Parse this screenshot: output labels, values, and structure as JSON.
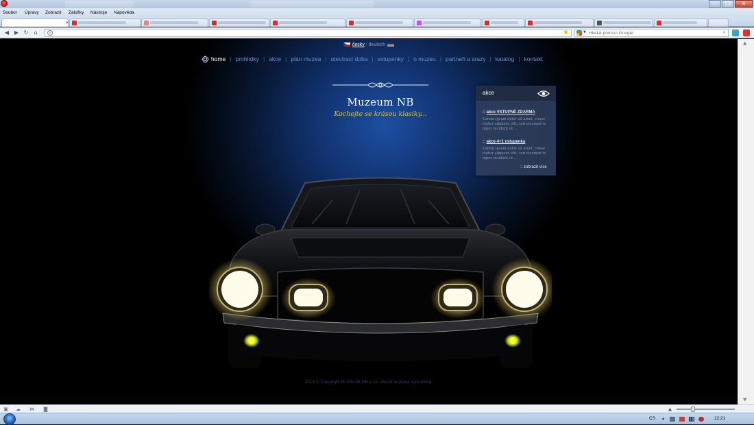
{
  "browser": {
    "menu": [
      "Soubor",
      "Úpravy",
      "Zobrazit",
      "Záložky",
      "Nástroje",
      "Nápověda"
    ],
    "tab_close": "×",
    "search_placeholder": "Hledat pomocí Google"
  },
  "page": {
    "language": {
      "czech": "česky",
      "separator": "|",
      "german": "deutsch"
    },
    "nav": [
      {
        "label": "home"
      },
      {
        "label": "prohlídky"
      },
      {
        "label": "akce"
      },
      {
        "label": "plán muzea"
      },
      {
        "label": "otevírací doba"
      },
      {
        "label": "vstupenky"
      },
      {
        "label": "o muzeu"
      },
      {
        "label": "partneři a srazy"
      },
      {
        "label": "katalog"
      },
      {
        "label": "kontakt"
      }
    ],
    "nav_separator": "|",
    "logo": {
      "title": "Muzeum NB",
      "tagline": "Kochejte se krásou klasiky..."
    },
    "akce_panel": {
      "heading": "akce",
      "items": [
        {
          "prefix": ":: ",
          "link": "akce VSTUPNÉ ZDARMA",
          "text": "Lorem ipsum dolor sit amet, conse ctetur adipisici elit, sed eiusmod te mpor incidunt ut ..."
        },
        {
          "prefix": ":: ",
          "link": "akce 4+1 vstupenka",
          "text": "Lorem ipsum dolor sit amet, conse ctetur adipisici elit, sed eiusmod te mpor incidunt ut ..."
        }
      ],
      "more": ":: zobrazit více"
    },
    "copyright": "2013 © Copyright MUZEUM NB s.r.o. Všechna práva vyhrazena."
  },
  "taskbar": {
    "language": "CS",
    "time": "12:21"
  },
  "colors": {
    "nav_link": "#6e8fc8",
    "tagline": "#d9c24a",
    "headlight": "#fffbe6",
    "fog_light": "#e6ff24"
  }
}
